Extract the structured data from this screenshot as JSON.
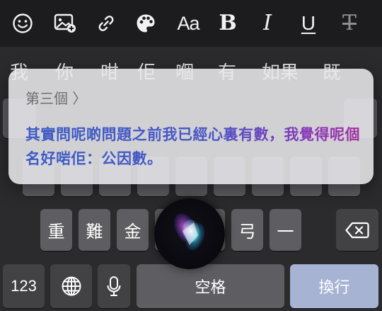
{
  "toolbar": {
    "aa_label": "Aa",
    "bold_label": "B",
    "italic_label": "I",
    "underline_label": "U",
    "strike_label": "T"
  },
  "candidates": [
    "我",
    "你",
    "咁",
    "佢",
    "嗰",
    "有",
    "如果",
    "既"
  ],
  "siri": {
    "heading": "第三個 〉",
    "text": "其實問呢啲問題之前我已經心裏有數，我覺得呢個名好啱佢：公因數。"
  },
  "keyboard": {
    "row3": [
      "重",
      "難",
      "金",
      "弓",
      "一"
    ],
    "numbers_label": "123",
    "space_label": "空格",
    "return_label": "換行"
  },
  "colors": {
    "siri_text_start": "#3b5bc4",
    "siri_text_end": "#a3309f",
    "return_key": "#a6b3d3"
  }
}
